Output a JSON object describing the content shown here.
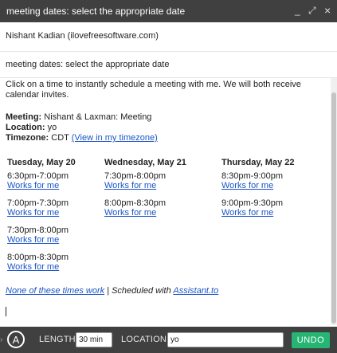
{
  "window": {
    "title": "meeting dates: select the appropriate date",
    "minimize": "_",
    "expand": "⤢",
    "close": "×"
  },
  "compose": {
    "from": "Nishant Kadian (ilovefreesoftware.com)",
    "subject": "meeting dates: select the appropriate date"
  },
  "body": {
    "intro": "Click on a time to instantly schedule a meeting with me. We will both receive calendar invites.",
    "meeting_label": "Meeting:",
    "meeting_value": "Nishant & Laxman: Meeting",
    "location_label": "Location:",
    "location_value": "yo",
    "timezone_label": "Timezone:",
    "timezone_value": "CDT",
    "timezone_link": "(View in my timezone)",
    "days": [
      {
        "name": "Tuesday, May 20",
        "slots": [
          {
            "time": "6:30pm-7:00pm",
            "link": "Works for me"
          },
          {
            "time": "7:00pm-7:30pm",
            "link": "Works for me"
          },
          {
            "time": "7:30pm-8:00pm",
            "link": "Works for me"
          },
          {
            "time": "8:00pm-8:30pm",
            "link": "Works for me"
          }
        ]
      },
      {
        "name": "Wednesday, May 21",
        "slots": [
          {
            "time": "7:30pm-8:00pm",
            "link": "Works for me"
          },
          {
            "time": "8:00pm-8:30pm",
            "link": "Works for me"
          }
        ]
      },
      {
        "name": "Thursday, May 22",
        "slots": [
          {
            "time": "8:30pm-9:00pm",
            "link": "Works for me"
          },
          {
            "time": "9:00pm-9:30pm",
            "link": "Works for me"
          }
        ]
      }
    ],
    "none_link": "None of these times work",
    "separator": " | Scheduled with ",
    "assistant_link": "Assistant.to"
  },
  "toolbar": {
    "logo_letter": "A",
    "length_label": "LENGTH",
    "length_value": "30 min",
    "location_label": "LOCATION",
    "location_value": "yo",
    "undo_label": "UNDO"
  },
  "colors": {
    "titlebar": "#404040",
    "link": "#1a55c7",
    "undo": "#26b573"
  }
}
